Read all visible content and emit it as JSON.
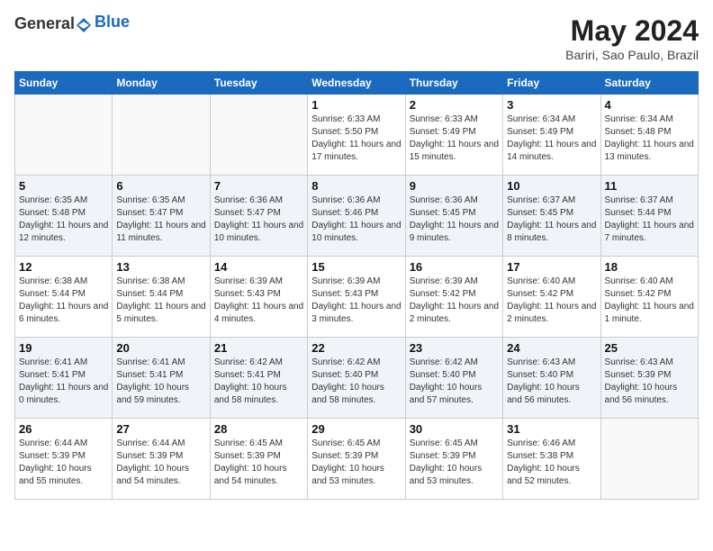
{
  "header": {
    "logo_general": "General",
    "logo_blue": "Blue",
    "title": "May 2024",
    "location": "Bariri, Sao Paulo, Brazil"
  },
  "weekdays": [
    "Sunday",
    "Monday",
    "Tuesday",
    "Wednesday",
    "Thursday",
    "Friday",
    "Saturday"
  ],
  "weeks": [
    [
      {
        "day": "",
        "info": ""
      },
      {
        "day": "",
        "info": ""
      },
      {
        "day": "",
        "info": ""
      },
      {
        "day": "1",
        "info": "Sunrise: 6:33 AM\nSunset: 5:50 PM\nDaylight: 11 hours and 17 minutes."
      },
      {
        "day": "2",
        "info": "Sunrise: 6:33 AM\nSunset: 5:49 PM\nDaylight: 11 hours and 15 minutes."
      },
      {
        "day": "3",
        "info": "Sunrise: 6:34 AM\nSunset: 5:49 PM\nDaylight: 11 hours and 14 minutes."
      },
      {
        "day": "4",
        "info": "Sunrise: 6:34 AM\nSunset: 5:48 PM\nDaylight: 11 hours and 13 minutes."
      }
    ],
    [
      {
        "day": "5",
        "info": "Sunrise: 6:35 AM\nSunset: 5:48 PM\nDaylight: 11 hours and 12 minutes."
      },
      {
        "day": "6",
        "info": "Sunrise: 6:35 AM\nSunset: 5:47 PM\nDaylight: 11 hours and 11 minutes."
      },
      {
        "day": "7",
        "info": "Sunrise: 6:36 AM\nSunset: 5:47 PM\nDaylight: 11 hours and 10 minutes."
      },
      {
        "day": "8",
        "info": "Sunrise: 6:36 AM\nSunset: 5:46 PM\nDaylight: 11 hours and 10 minutes."
      },
      {
        "day": "9",
        "info": "Sunrise: 6:36 AM\nSunset: 5:45 PM\nDaylight: 11 hours and 9 minutes."
      },
      {
        "day": "10",
        "info": "Sunrise: 6:37 AM\nSunset: 5:45 PM\nDaylight: 11 hours and 8 minutes."
      },
      {
        "day": "11",
        "info": "Sunrise: 6:37 AM\nSunset: 5:44 PM\nDaylight: 11 hours and 7 minutes."
      }
    ],
    [
      {
        "day": "12",
        "info": "Sunrise: 6:38 AM\nSunset: 5:44 PM\nDaylight: 11 hours and 6 minutes."
      },
      {
        "day": "13",
        "info": "Sunrise: 6:38 AM\nSunset: 5:44 PM\nDaylight: 11 hours and 5 minutes."
      },
      {
        "day": "14",
        "info": "Sunrise: 6:39 AM\nSunset: 5:43 PM\nDaylight: 11 hours and 4 minutes."
      },
      {
        "day": "15",
        "info": "Sunrise: 6:39 AM\nSunset: 5:43 PM\nDaylight: 11 hours and 3 minutes."
      },
      {
        "day": "16",
        "info": "Sunrise: 6:39 AM\nSunset: 5:42 PM\nDaylight: 11 hours and 2 minutes."
      },
      {
        "day": "17",
        "info": "Sunrise: 6:40 AM\nSunset: 5:42 PM\nDaylight: 11 hours and 2 minutes."
      },
      {
        "day": "18",
        "info": "Sunrise: 6:40 AM\nSunset: 5:42 PM\nDaylight: 11 hours and 1 minute."
      }
    ],
    [
      {
        "day": "19",
        "info": "Sunrise: 6:41 AM\nSunset: 5:41 PM\nDaylight: 11 hours and 0 minutes."
      },
      {
        "day": "20",
        "info": "Sunrise: 6:41 AM\nSunset: 5:41 PM\nDaylight: 10 hours and 59 minutes."
      },
      {
        "day": "21",
        "info": "Sunrise: 6:42 AM\nSunset: 5:41 PM\nDaylight: 10 hours and 58 minutes."
      },
      {
        "day": "22",
        "info": "Sunrise: 6:42 AM\nSunset: 5:40 PM\nDaylight: 10 hours and 58 minutes."
      },
      {
        "day": "23",
        "info": "Sunrise: 6:42 AM\nSunset: 5:40 PM\nDaylight: 10 hours and 57 minutes."
      },
      {
        "day": "24",
        "info": "Sunrise: 6:43 AM\nSunset: 5:40 PM\nDaylight: 10 hours and 56 minutes."
      },
      {
        "day": "25",
        "info": "Sunrise: 6:43 AM\nSunset: 5:39 PM\nDaylight: 10 hours and 56 minutes."
      }
    ],
    [
      {
        "day": "26",
        "info": "Sunrise: 6:44 AM\nSunset: 5:39 PM\nDaylight: 10 hours and 55 minutes."
      },
      {
        "day": "27",
        "info": "Sunrise: 6:44 AM\nSunset: 5:39 PM\nDaylight: 10 hours and 54 minutes."
      },
      {
        "day": "28",
        "info": "Sunrise: 6:45 AM\nSunset: 5:39 PM\nDaylight: 10 hours and 54 minutes."
      },
      {
        "day": "29",
        "info": "Sunrise: 6:45 AM\nSunset: 5:39 PM\nDaylight: 10 hours and 53 minutes."
      },
      {
        "day": "30",
        "info": "Sunrise: 6:45 AM\nSunset: 5:39 PM\nDaylight: 10 hours and 53 minutes."
      },
      {
        "day": "31",
        "info": "Sunrise: 6:46 AM\nSunset: 5:38 PM\nDaylight: 10 hours and 52 minutes."
      },
      {
        "day": "",
        "info": ""
      }
    ]
  ]
}
